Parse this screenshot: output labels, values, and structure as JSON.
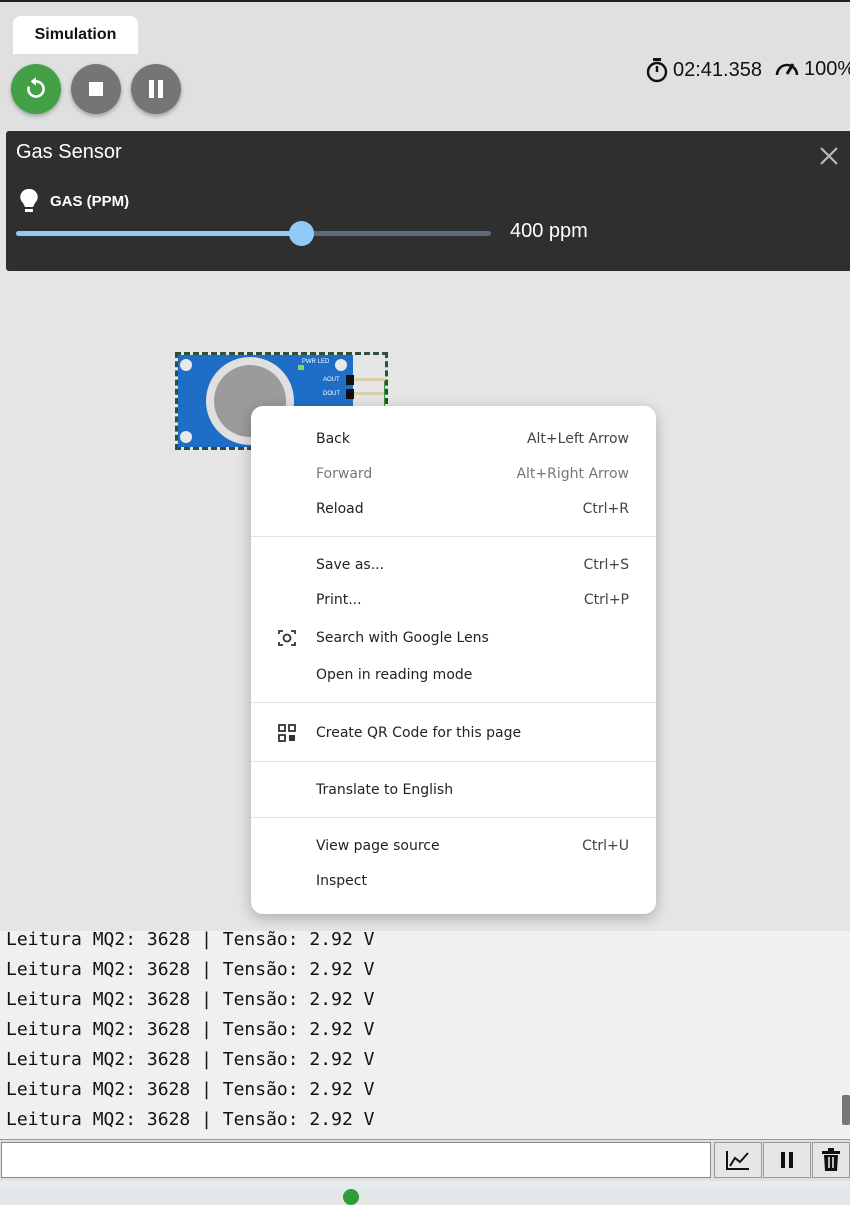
{
  "toolbar": {
    "tab_label": "Simulation",
    "timer": "02:41.358",
    "speed": "100%",
    "colors": {
      "restart": "#43a047",
      "stop": "#757575",
      "pause": "#757575"
    }
  },
  "gas_panel": {
    "title": "Gas Sensor",
    "control_label": "GAS (PPM)",
    "value_text": "400 ppm",
    "slider_fraction": 0.6,
    "accent": "#90caf9"
  },
  "sensor_board": {
    "pwr_led": "PWR LED",
    "pins": [
      "AOUT",
      "DOUT"
    ]
  },
  "context_menu": {
    "items": [
      {
        "label": "Back",
        "shortcut": "Alt+Left Arrow"
      },
      {
        "label": "Forward",
        "shortcut": "Alt+Right Arrow"
      },
      {
        "label": "Reload",
        "shortcut": "Ctrl+R"
      },
      {
        "label": "Save as...",
        "shortcut": "Ctrl+S"
      },
      {
        "label": "Print...",
        "shortcut": "Ctrl+P"
      },
      {
        "label": "Search with Google Lens",
        "shortcut": ""
      },
      {
        "label": "Open in reading mode",
        "shortcut": ""
      },
      {
        "label": "Create QR Code for this page",
        "shortcut": ""
      },
      {
        "label": "Translate to English",
        "shortcut": ""
      },
      {
        "label": "View page source",
        "shortcut": "Ctrl+U"
      },
      {
        "label": "Inspect",
        "shortcut": ""
      }
    ]
  },
  "console": {
    "lines": [
      "Leitura MQ2: 3628 | Tensão: 2.92 V",
      "Leitura MQ2: 3628 | Tensão: 2.92 V",
      "Leitura MQ2: 3628 | Tensão: 2.92 V",
      "Leitura MQ2: 3628 | Tensão: 2.92 V",
      "Leitura MQ2: 3628 | Tensão: 2.92 V",
      "Leitura MQ2: 3628 | Tensão: 2.92 V",
      "Leitura MQ2: 3628 | Tensão: 2.92 V"
    ],
    "input_value": ""
  }
}
